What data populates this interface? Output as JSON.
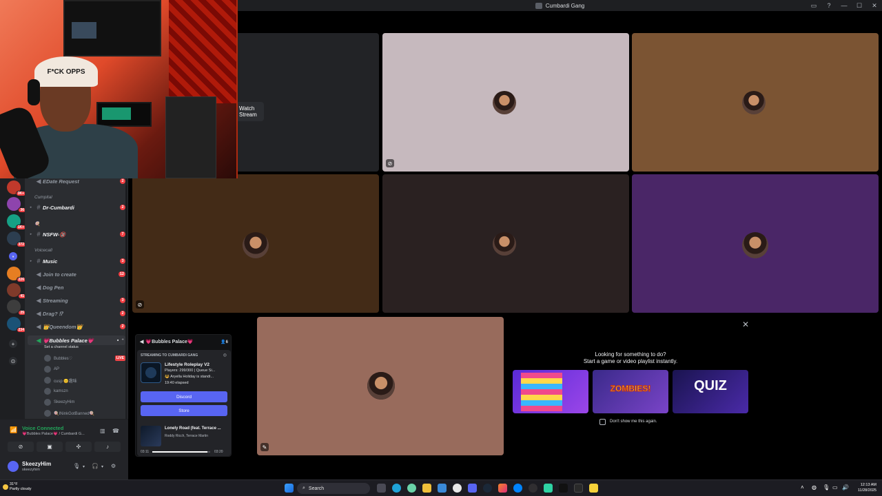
{
  "window": {
    "title": "Cumbardi Gang"
  },
  "stream": {
    "watch_label": "Watch Stream"
  },
  "webcam": {
    "cap_text": "F*CK OPPS"
  },
  "servers": {
    "badges": [
      "3K+",
      "36",
      "1K+",
      "372",
      "226",
      "41",
      "25",
      "234"
    ]
  },
  "channels": {
    "items": [
      {
        "name": "EDate Request",
        "badge": "2"
      },
      {
        "name": "Dr-Cumbardi",
        "badge": "2"
      },
      {
        "name": "NSFW-🔞",
        "badge": "7"
      },
      {
        "name": "Music",
        "badge": "3"
      },
      {
        "name": "Join to create",
        "badge": "12"
      },
      {
        "name": "Dog Pen",
        "badge": ""
      },
      {
        "name": "Streaming",
        "badge": "3"
      },
      {
        "name": "Drag? ⁉",
        "badge": "2"
      },
      {
        "name": "👑Queendom👑",
        "badge": "2"
      },
      {
        "name": "💗Bubbles Palace💗",
        "badge": ""
      }
    ],
    "categories": [
      "Cumpital",
      "🍭",
      "Voicecall"
    ],
    "set_status": "Set a channel status",
    "voice_users": [
      {
        "name": "Bubbles♡",
        "live": "LIVE"
      },
      {
        "name": "AP"
      },
      {
        "name": "cusp 😊趣味"
      },
      {
        "name": "kamszn"
      },
      {
        "name": "SkeezyHim"
      },
      {
        "name": "🍭INinkGotBanned🍭"
      }
    ]
  },
  "voice": {
    "status": "Voice Connected",
    "location": "💗Bubbles Palace💗 / Cumbardi G...",
    "user": {
      "name": "SkeezyHim",
      "tag": "skeezyhim"
    }
  },
  "popout": {
    "channel": "💗Bubbles Palace💗",
    "count": "6",
    "label": "STREAMING TO CUMBARDI GANG",
    "game": {
      "title": "Lifestyle Roleplay V2",
      "line1": "Players: 299/300 | Queue Si...",
      "line2": "🔱 Aryella Holiday is standi...",
      "line3": "19:40 elapsed"
    },
    "btn_discord": "Discord",
    "btn_store": "Store",
    "track": {
      "title": "Lonely Road (feat. Terrace ...",
      "artist": "Roddy Ricch, Terrace Martin",
      "elapsed": "03:11",
      "total": "03:20",
      "progress": 0.95
    }
  },
  "activity": {
    "line1": "Looking for something to do?",
    "line2": "Start a game or video playlist instantly.",
    "cards": [
      {
        "label": ""
      },
      {
        "label": "ZOMBIES!"
      },
      {
        "label": "QUIZ"
      }
    ],
    "dont_show": "Don't show me this again."
  },
  "taskbar": {
    "weather_temp": "31°F",
    "weather_desc": "Partly cloudy",
    "search": "Search",
    "time": "12:13 AM",
    "date": "11/28/2025"
  },
  "colors": {
    "tile_gray": "#c6b9be",
    "tile_brown": "#7b5433",
    "tile_darkbrown": "#432b17",
    "tile_darkgray": "#2a2121",
    "tile_purple": "#4a2667",
    "tile_tan": "#986b5c",
    "accent": "#5865f2"
  }
}
